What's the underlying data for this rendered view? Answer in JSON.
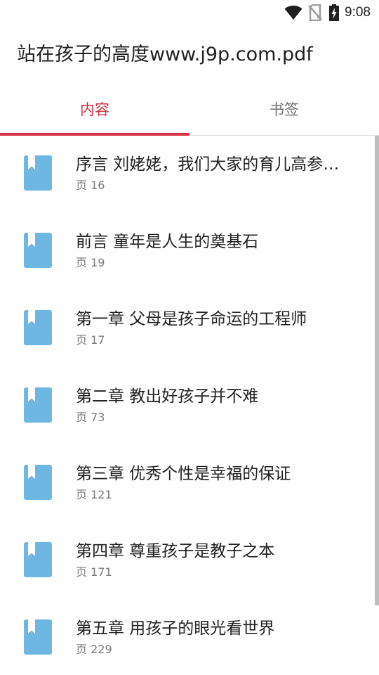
{
  "status_bar": {
    "time": "9:08",
    "icons": [
      "wifi-icon",
      "no-sim-icon",
      "battery-charging-icon"
    ]
  },
  "app_bar": {
    "title": "站在孩子的高度www.j9p.com.pdf"
  },
  "tabs": [
    {
      "label": "内容",
      "active": true
    },
    {
      "label": "书签",
      "active": false
    }
  ],
  "colors": {
    "accent": "#d23240",
    "bookmark": "#6fb7e3"
  },
  "toc": {
    "items": [
      {
        "title": "序言  刘姥姥，我们大家的育儿高参…",
        "page": "页 16",
        "icon": "bookmark-icon"
      },
      {
        "title": "前言  童年是人生的奠基石",
        "page": "页 19",
        "icon": "bookmark-icon"
      },
      {
        "title": "第一章  父母是孩子命运的工程师",
        "page": "页 17",
        "icon": "bookmark-icon"
      },
      {
        "title": "第二章  教出好孩子并不难",
        "page": "页 73",
        "icon": "bookmark-icon"
      },
      {
        "title": "第三章  优秀个性是幸福的保证",
        "page": "页 121",
        "icon": "bookmark-icon"
      },
      {
        "title": "第四章  尊重孩子是教子之本",
        "page": "页 171",
        "icon": "bookmark-icon"
      },
      {
        "title": "第五章  用孩子的眼光看世界",
        "page": "页 229",
        "icon": "bookmark-icon"
      }
    ]
  }
}
